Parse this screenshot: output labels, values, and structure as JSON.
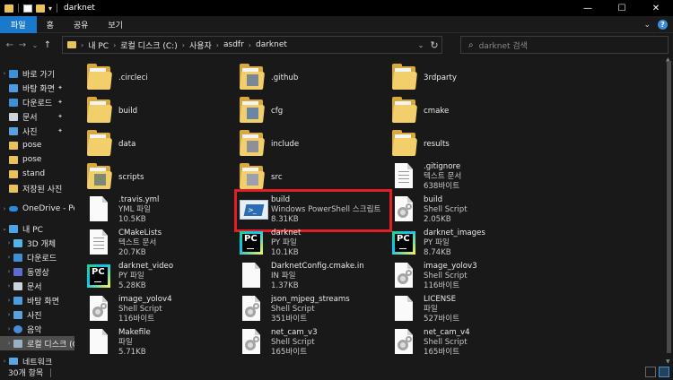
{
  "window": {
    "title": "darknet",
    "minimize_glyph": "—",
    "maximize_glyph": "☐",
    "close_glyph": "✕"
  },
  "ribbon": {
    "tabs": [
      "파일",
      "홈",
      "공유",
      "보기"
    ],
    "expand_glyph": "⌄",
    "help_glyph": "?"
  },
  "address": {
    "back_glyph": "←",
    "forward_glyph": "→",
    "recent_glyph": "⌄",
    "up_glyph": "↑",
    "crumbs": [
      "내 PC",
      "로컬 디스크 (C:)",
      "사용자",
      "asdfr",
      "darknet"
    ],
    "sep_glyph": "›",
    "dropdown_glyph": "⌄",
    "refresh_glyph": "↻"
  },
  "search": {
    "icon": "search-icon",
    "icon_glyph": "⌕",
    "placeholder": "darknet 검색"
  },
  "sidebar": {
    "items": [
      {
        "label": "바로 가기",
        "icon": "star-icon",
        "chevron": "›",
        "pinned": false
      },
      {
        "label": "바탕 화면",
        "icon": "desktop-icon",
        "chevron": "",
        "pinned": true
      },
      {
        "label": "다운로드",
        "icon": "download-icon",
        "chevron": "",
        "pinned": true
      },
      {
        "label": "문서",
        "icon": "document-icon",
        "chevron": "",
        "pinned": true
      },
      {
        "label": "사진",
        "icon": "picture-icon",
        "chevron": "",
        "pinned": true
      },
      {
        "label": "pose",
        "icon": "folder-icon",
        "chevron": "",
        "pinned": false
      },
      {
        "label": "pose",
        "icon": "folder-icon",
        "chevron": "",
        "pinned": false
      },
      {
        "label": "stand",
        "icon": "folder-icon",
        "chevron": "",
        "pinned": false
      },
      {
        "label": "저장된 사진",
        "icon": "folder-icon",
        "chevron": "",
        "pinned": false
      },
      {
        "label": "OneDrive - Personal",
        "icon": "cloud-icon",
        "chevron": "›",
        "pinned": false
      },
      {
        "label": "내 PC",
        "icon": "pc-icon",
        "chevron": "⌄",
        "pinned": false
      },
      {
        "label": "3D 개체",
        "icon": "3d-objects-icon",
        "chevron": "›",
        "pinned": false
      },
      {
        "label": "다운로드",
        "icon": "download-icon",
        "chevron": "›",
        "pinned": false
      },
      {
        "label": "동영상",
        "icon": "video-icon",
        "chevron": "›",
        "pinned": false
      },
      {
        "label": "문서",
        "icon": "document-icon",
        "chevron": "›",
        "pinned": false
      },
      {
        "label": "바탕 화면",
        "icon": "desktop-icon",
        "chevron": "›",
        "pinned": false
      },
      {
        "label": "사진",
        "icon": "picture-icon",
        "chevron": "›",
        "pinned": false
      },
      {
        "label": "음악",
        "icon": "music-icon",
        "chevron": "›",
        "pinned": false
      },
      {
        "label": "로컬 디스크 (C:)",
        "icon": "drive-icon",
        "chevron": "›",
        "pinned": false,
        "active": true
      },
      {
        "label": "네트워크",
        "icon": "network-icon",
        "chevron": "›",
        "pinned": false
      }
    ],
    "pin_glyph": "📌"
  },
  "files": [
    {
      "name": ".circleci",
      "sub": "",
      "sub2": "",
      "icon": "folder-icon"
    },
    {
      "name": ".github",
      "sub": "",
      "sub2": "",
      "icon": "folder-icon"
    },
    {
      "name": "3rdparty",
      "sub": "",
      "sub2": "",
      "icon": "folder-icon"
    },
    {
      "name": "build",
      "sub": "",
      "sub2": "",
      "icon": "folder-icon"
    },
    {
      "name": "cfg",
      "sub": "",
      "sub2": "",
      "icon": "folder-icon"
    },
    {
      "name": "cmake",
      "sub": "",
      "sub2": "",
      "icon": "folder-icon"
    },
    {
      "name": "data",
      "sub": "",
      "sub2": "",
      "icon": "folder-icon"
    },
    {
      "name": "include",
      "sub": "",
      "sub2": "",
      "icon": "folder-icon"
    },
    {
      "name": "results",
      "sub": "",
      "sub2": "",
      "icon": "folder-icon"
    },
    {
      "name": "scripts",
      "sub": "",
      "sub2": "",
      "icon": "folder-icon"
    },
    {
      "name": "src",
      "sub": "",
      "sub2": "",
      "icon": "folder-icon"
    },
    {
      "name": ".gitignore",
      "sub": "텍스트 문서",
      "sub2": "638바이트",
      "icon": "text-file-icon"
    },
    {
      "name": ".travis.yml",
      "sub": "YML 파일",
      "sub2": "10.5KB",
      "icon": "blank-file-icon"
    },
    {
      "name": "build",
      "sub": "Windows PowerShell 스크립트",
      "sub2": "8.31KB",
      "icon": "powershell-icon"
    },
    {
      "name": "build",
      "sub": "Shell Script",
      "sub2": "2.05KB",
      "icon": "shell-script-icon"
    },
    {
      "name": "CMakeLists",
      "sub": "텍스트 문서",
      "sub2": "20.7KB",
      "icon": "text-file-icon"
    },
    {
      "name": "darknet",
      "sub": "PY 파일",
      "sub2": "10.1KB",
      "icon": "pycharm-icon"
    },
    {
      "name": "darknet_images",
      "sub": "PY 파일",
      "sub2": "8.74KB",
      "icon": "pycharm-icon"
    },
    {
      "name": "darknet_video",
      "sub": "PY 파일",
      "sub2": "5.28KB",
      "icon": "pycharm-icon"
    },
    {
      "name": "DarknetConfig.cmake.in",
      "sub": "IN 파일",
      "sub2": "1.37KB",
      "icon": "blank-file-icon"
    },
    {
      "name": "image_yolov3",
      "sub": "Shell Script",
      "sub2": "116바이트",
      "icon": "shell-script-icon"
    },
    {
      "name": "image_yolov4",
      "sub": "Shell Script",
      "sub2": "116바이트",
      "icon": "shell-script-icon"
    },
    {
      "name": "json_mjpeg_streams",
      "sub": "Shell Script",
      "sub2": "351바이트",
      "icon": "shell-script-icon"
    },
    {
      "name": "LICENSE",
      "sub": "파일",
      "sub2": "527바이트",
      "icon": "blank-file-icon"
    },
    {
      "name": "Makefile",
      "sub": "파일",
      "sub2": "5.71KB",
      "icon": "blank-file-icon"
    },
    {
      "name": "net_cam_v3",
      "sub": "Shell Script",
      "sub2": "165바이트",
      "icon": "shell-script-icon"
    },
    {
      "name": "net_cam_v4",
      "sub": "Shell Script",
      "sub2": "165바이트",
      "icon": "shell-script-icon"
    }
  ],
  "highlighted_file_index": 13,
  "pycharm_logo_text": "PC",
  "powershell_logo_text": ">_",
  "status": {
    "item_count": "30개 항목"
  },
  "colors": {
    "accent": "#1979ca",
    "highlight_box": "#e21f26",
    "folder": "#f3cf6b"
  }
}
